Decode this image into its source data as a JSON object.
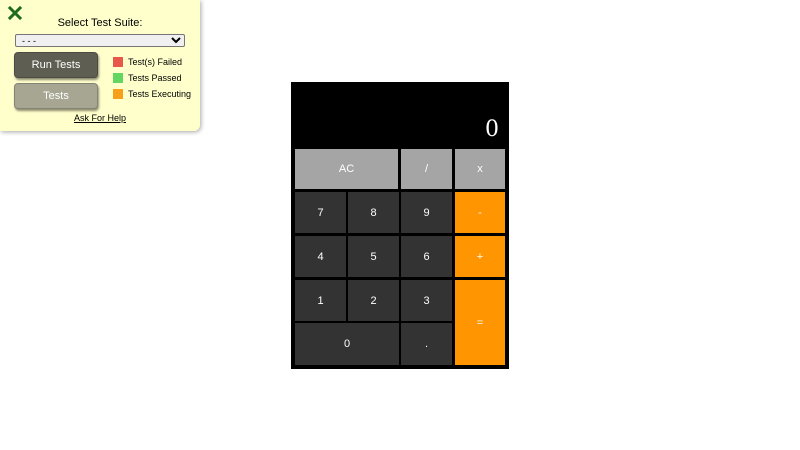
{
  "test_panel": {
    "title": "Select Test Suite:",
    "suite_select": {
      "selected": "- - -",
      "options": [
        "- - -"
      ]
    },
    "run_button": "Run Tests",
    "tests_button": "Tests",
    "legend": [
      {
        "label": "Test(s) Failed",
        "color": "#e8584a"
      },
      {
        "label": "Tests Passed",
        "color": "#61d660"
      },
      {
        "label": "Tests Executing",
        "color": "#f79e1b"
      }
    ],
    "help_link": "Ask For Help",
    "close_icon": "close-x-icon",
    "close_color": "#1e6b1e"
  },
  "calculator": {
    "display": "0",
    "keys": {
      "ac": "AC",
      "divide": "/",
      "multiply": "x",
      "seven": "7",
      "eight": "8",
      "nine": "9",
      "subtract": "-",
      "four": "4",
      "five": "5",
      "six": "6",
      "add": "+",
      "one": "1",
      "two": "2",
      "three": "3",
      "equals": "=",
      "zero": "0",
      "decimal": "."
    },
    "colors": {
      "body": "#000000",
      "function_key": "#a5a5a5",
      "number_key": "#333333",
      "operator_key": "#ff9500"
    }
  }
}
